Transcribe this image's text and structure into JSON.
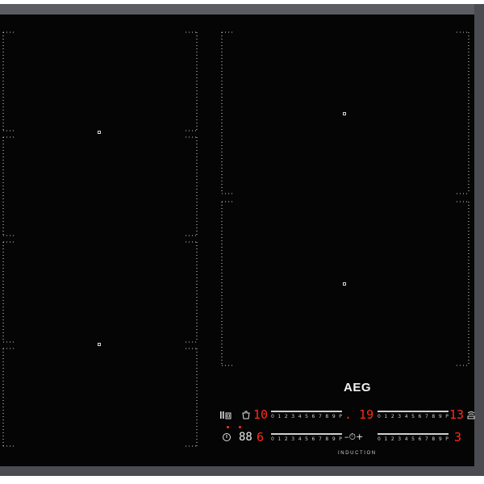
{
  "brand": {
    "logo_text": "AEG",
    "subtitle": "INDUCTION"
  },
  "colors": {
    "glass": "#050506",
    "frame": "#4a4c52",
    "display_red": "#ff2a1a",
    "marking": "#cfcfcf"
  },
  "controls": {
    "row1": {
      "pause_icon": "pause-lock-icon",
      "bridge_icon": "pot-icon",
      "left_power_display": "10",
      "left_scale": "0 1 2 3 4 5 6 7 8 9 P",
      "timer_display": ". 19",
      "right_scale": "0 1 2 3 4 5 6 7 8 9 P",
      "right_power_display": "13",
      "hob2hood_icon": "hood-icon"
    },
    "row2": {
      "power_icon": "power-icon",
      "timer_icon_display": "88",
      "left_power_display": "6",
      "left_scale": "0 1 2 3 4 5 6 7 8 9 P",
      "timer_minus_plus": "–⏱+",
      "right_scale": "0 1 2 3 4 5 6 7 8 9 P",
      "right_power_display": "3"
    }
  }
}
